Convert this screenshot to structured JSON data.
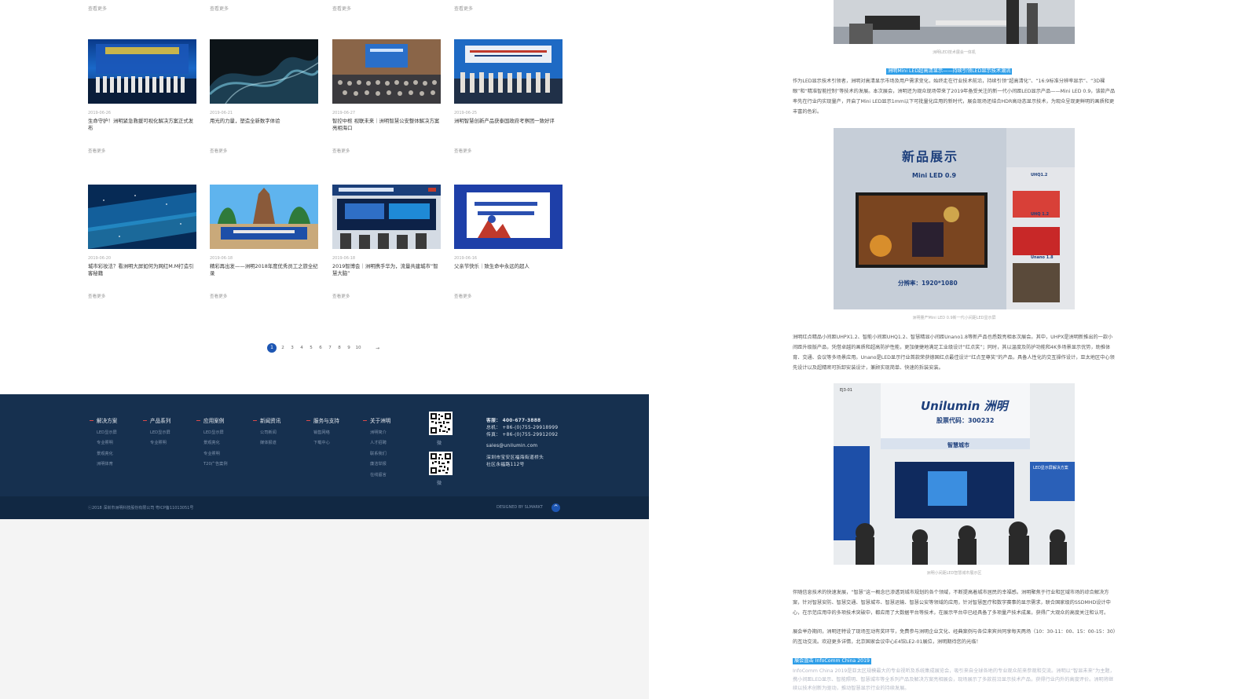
{
  "left": {
    "more_label": "查看更多",
    "news_row1": [
      {
        "date": "2019-06-26",
        "title": "生命守护！洲明紧急救援可视化解决方案正式发布"
      },
      {
        "date": "2019-06-21",
        "title": "用光的力量，塑造全新数字体验"
      },
      {
        "date": "2019-06-27",
        "title": "智控中枢 视联未来｜洲明智慧公安整体解决方案亮相海口"
      },
      {
        "date": "2019-06-25",
        "title": "洲明智慧创新产品获泰国政府考察团一致好评"
      }
    ],
    "news_row2": [
      {
        "date": "2019-06-20",
        "title": "城市彩妆法？看洲明大屏如何为网红M.M打造引客秘籍"
      },
      {
        "date": "2019-06-18",
        "title": "精彩再出发——洲明2018年度优秀员工之旅全纪录"
      },
      {
        "date": "2019-06-18",
        "title": "2019智博会｜洲明携手华为，流量共建城市“智慧大脑”"
      },
      {
        "date": "2019-06-16",
        "title": "父亲节快乐｜致生命中永远的超人"
      }
    ],
    "pagination": {
      "pages": [
        "1",
        "2",
        "3",
        "4",
        "5",
        "6",
        "7",
        "8",
        "9",
        "10"
      ],
      "active": "1",
      "next": "→"
    },
    "footer": {
      "columns": [
        {
          "title": "解决方案",
          "items": [
            "LED显示屏",
            "专业照明",
            "景观亮化",
            "洲明体育"
          ]
        },
        {
          "title": "产品系列",
          "items": [
            "LED显示屏",
            "专业照明"
          ]
        },
        {
          "title": "应用案例",
          "items": [
            "LED显示屏",
            "景观亮化",
            "专业照明",
            "T20广告案例"
          ]
        },
        {
          "title": "新闻资讯",
          "items": [
            "公司新闻",
            "媒体报道"
          ]
        },
        {
          "title": "服务与支持",
          "items": [
            "销售网络",
            "下载中心"
          ]
        },
        {
          "title": "关于洲明",
          "items": [
            "洲明简介",
            "人才招聘",
            "联系我们",
            "廉洁举报",
            "在线留言"
          ]
        }
      ],
      "qr_caption_1": "微",
      "qr_caption_2": "微",
      "contact": {
        "hotline": "客服： 400-677-3888",
        "phone": "总机： +86-(0)755-29918999",
        "fax": "传真： +86-(0)755-29912092",
        "email": "sales@unilumin.com",
        "address_1": "深圳市宝安区福海街道桥头",
        "address_2": "社区永福路112号"
      },
      "copyright": "ⓒ2018 深圳市洲明科技股份有限公司 粤ICP备11013051号",
      "designed": "DESIGNED BY SLMARKT",
      "to_top": "^"
    }
  },
  "right": {
    "caption_top": "洲明LED技术展会一体机",
    "heading_1": "洲明Mini LED超高清显示——持续引领LED显示技术潮流",
    "para_1": "作为LED显示技术引领者，洲明对高清显示市场及用户需求变化，始终走在行业技术前沿，持续引领“超高清化”、“16:9标准分辨率显示”、“3D裸眼”和“精准智能控制”等技术的发展。本次展会，洲明还为观众现场带来了2019年备受关注的新一代小间距LED显示产品——Mini LED 0.9，该款产品率先在行业内实现量产，开启了Mini LED显示1mm以下可批量化应用的新时代，展会现场还结合HDR高动态显示技术，为观众呈现更鲜明的画质和更丰富的色彩。",
    "new_product_title": "新品展示",
    "mini_led_label": "Mini LED 0.9",
    "resolution_label": "分辨率：1920*1080",
    "uhq_label_1": "UHQ1.2",
    "uhq_label_2": "UHQ 1.2",
    "unano_label": "Unano 1.8",
    "caption_mid": "洲明量产Mini LED 0.9新一代小间距LED显示屏",
    "para_2": "洲明红点精品小间距UHPX1.2、智能小间距UHQ1.2、智慧精显小间距Unano1.8等新产品也悉数亮相本次展会。其中，UHPX是洲明新推出的一款小间距升级版产品，凭借卓越的画质和超高防护性能，更加便捷地满足工业级设计“红点奖”；同时，其以温度及防护功能和4K多场景显示优势，助推体育、交通、会议等多场景应用。Unano是LED显示行业首款荣获德国红点最佳设计“红点至尊奖”的产品，具备人性化的交互操作设计，亚太地区中心领先设计以及超精密可拆卸安装设计，兼顾实现简单、快速的拆装安装。",
    "booth_brand": "Unilumin 洲明",
    "booth_stock": "股票代码：300232",
    "booth_city": "智慧城市",
    "booth_tag": "EJ3-01",
    "booth_side": "LED显示屏解决方案",
    "caption_bottom": "洲明小间距LED智慧城市展示区",
    "para_3": "伴随信息技术的快速发展，“智慧”这一概念已渗透到城市规划的各个领域，不断提高着城市居民的幸福感。洲明聚焦于行业和区域市场的综合解决方案，针对智慧安防、智慧交通、智慧城市、智慧运输、智慧公安等领域的应用，针对智慧医疗和数字赛事的显示需求，联合国家级的SSDMHD设计中心，在示范应用中的多项技术突破中，都应用了大数据平台等技术，在展示平台中已经具备了多项量产技术成果，获得广大观众的高度关注和认可。",
    "para_4": "展会举办期间，洲明还特设了现场互动有奖环节，免费参与洲明企业文化、经典案例与各位来宾共同享每天两场（10：30-11：00、15：00-15：30）的互动交流。欢迎更多详情，北京国家会议中心E4馆LE2-01展位，洲明期待您的光临！",
    "heading_2": "展会直击 InfoComm China 2019",
    "para_5": "InfoComm China 2019是亚太区规模最大的专业视听及系统集成展览会，吸引来自全球各地的专业观众前来参观和交流。洲明以“智显未来”为主题，携小间距LED显示、智能照明、智慧城市等全系列产品及解决方案亮相展会，现场展示了多款前沿显示技术产品，获得行业内外的高度评价。洲明将继续以技术创新为驱动，推动智慧显示行业的持续发展。"
  }
}
